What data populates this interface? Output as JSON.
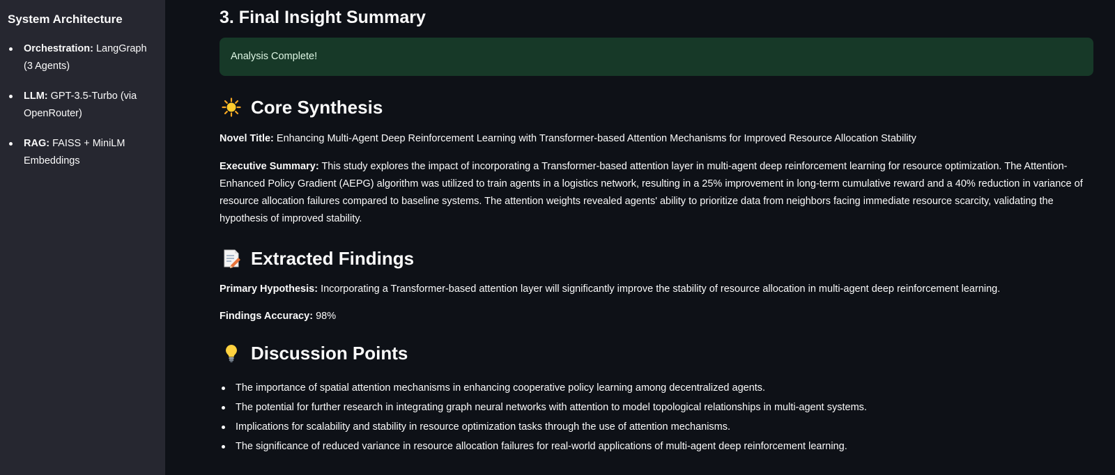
{
  "sidebar": {
    "title": "System Architecture",
    "items": [
      {
        "label": "Orchestration:",
        "value": "LangGraph (3 Agents)"
      },
      {
        "label": "LLM:",
        "value": "GPT-3.5-Turbo (via OpenRouter)"
      },
      {
        "label": "RAG:",
        "value": "FAISS + MiniLM Embeddings"
      }
    ]
  },
  "main": {
    "heading": "3. Final Insight Summary",
    "status_message": "Analysis Complete!",
    "core": {
      "heading": "Core Synthesis",
      "icon": "glowing-star-icon",
      "title_label": "Novel Title:",
      "title_value": "Enhancing Multi-Agent Deep Reinforcement Learning with Transformer-based Attention Mechanisms for Improved Resource Allocation Stability",
      "summary_label": "Executive Summary:",
      "summary_value": "This study explores the impact of incorporating a Transformer-based attention layer in multi-agent deep reinforcement learning for resource optimization. The Attention-Enhanced Policy Gradient (AEPG) algorithm was utilized to train agents in a logistics network, resulting in a 25% improvement in long-term cumulative reward and a 40% reduction in variance of resource allocation failures compared to baseline systems. The attention weights revealed agents' ability to prioritize data from neighbors facing immediate resource scarcity, validating the hypothesis of improved stability."
    },
    "findings": {
      "heading": "Extracted Findings",
      "icon": "memo-icon",
      "hypothesis_label": "Primary Hypothesis:",
      "hypothesis_value": "Incorporating a Transformer-based attention layer will significantly improve the stability of resource allocation in multi-agent deep reinforcement learning.",
      "accuracy_label": "Findings Accuracy:",
      "accuracy_value": "98%"
    },
    "discussion": {
      "heading": "Discussion Points",
      "icon": "light-bulb-icon",
      "points": [
        "The importance of spatial attention mechanisms in enhancing cooperative policy learning among decentralized agents.",
        "The potential for further research in integrating graph neural networks with attention to model topological relationships in multi-agent systems.",
        "Implications for scalability and stability in resource optimization tasks through the use of attention mechanisms.",
        "The significance of reduced variance in resource allocation failures for real-world applications of multi-agent deep reinforcement learning."
      ]
    }
  }
}
